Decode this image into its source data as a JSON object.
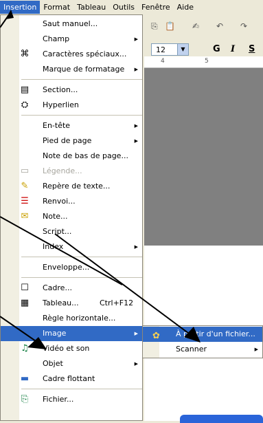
{
  "menubar": [
    {
      "label": "Insertion",
      "active": true
    },
    {
      "label": "Format"
    },
    {
      "label": "Tableau"
    },
    {
      "label": "Outils"
    },
    {
      "label": "Fenêtre"
    },
    {
      "label": "Aide"
    }
  ],
  "toolbar": {
    "font_size": "12",
    "bold": "G",
    "italic": "I",
    "underline": "S"
  },
  "ruler": {
    "mark_a": "4",
    "mark_b": "5"
  },
  "menu": {
    "items": [
      {
        "label": "Saut manuel...",
        "icon": "",
        "sub": false
      },
      {
        "label": "Champ",
        "icon": "",
        "sub": true
      },
      {
        "label": "Caractères spéciaux...",
        "icon": "⌘",
        "sub": false
      },
      {
        "label": "Marque de formatage",
        "icon": "",
        "sub": true
      },
      {
        "label": "Section...",
        "icon": "▤",
        "sub": false
      },
      {
        "label": "Hyperlien",
        "icon": "⛭",
        "sub": false
      },
      {
        "label": "En-tête",
        "icon": "",
        "sub": true
      },
      {
        "label": "Pied de page",
        "icon": "",
        "sub": true
      },
      {
        "label": "Note de bas de page...",
        "icon": "",
        "sub": false
      },
      {
        "label": "Légende...",
        "icon": "▭",
        "sub": false,
        "disabled": true
      },
      {
        "label": "Repère de texte...",
        "icon": "✎",
        "sub": false
      },
      {
        "label": "Renvoi...",
        "icon": "☰",
        "sub": false
      },
      {
        "label": "Note...",
        "icon": "✉",
        "sub": false
      },
      {
        "label": "Script...",
        "icon": "",
        "sub": false
      },
      {
        "label": "Index",
        "icon": "",
        "sub": true
      },
      {
        "label": "Enveloppe...",
        "icon": "",
        "sub": false
      },
      {
        "label": "Cadre...",
        "icon": "☐",
        "sub": false
      },
      {
        "label": "Tableau...",
        "icon": "▦",
        "sub": false,
        "shortcut": "Ctrl+F12"
      },
      {
        "label": "Règle horizontale...",
        "icon": "",
        "sub": false
      },
      {
        "label": "Image",
        "icon": "",
        "sub": true,
        "highlight": true
      },
      {
        "label": "Vidéo et son",
        "icon": "♫",
        "sub": false
      },
      {
        "label": "Objet",
        "icon": "",
        "sub": true
      },
      {
        "label": "Cadre flottant",
        "icon": "▬",
        "sub": false
      },
      {
        "label": "Fichier...",
        "icon": "⎘",
        "sub": false
      }
    ]
  },
  "submenu": {
    "items": [
      {
        "label": "À partir d'un fichier...",
        "icon": "✿",
        "highlight": true
      },
      {
        "label": "Scanner",
        "icon": "",
        "sub": true
      }
    ]
  }
}
